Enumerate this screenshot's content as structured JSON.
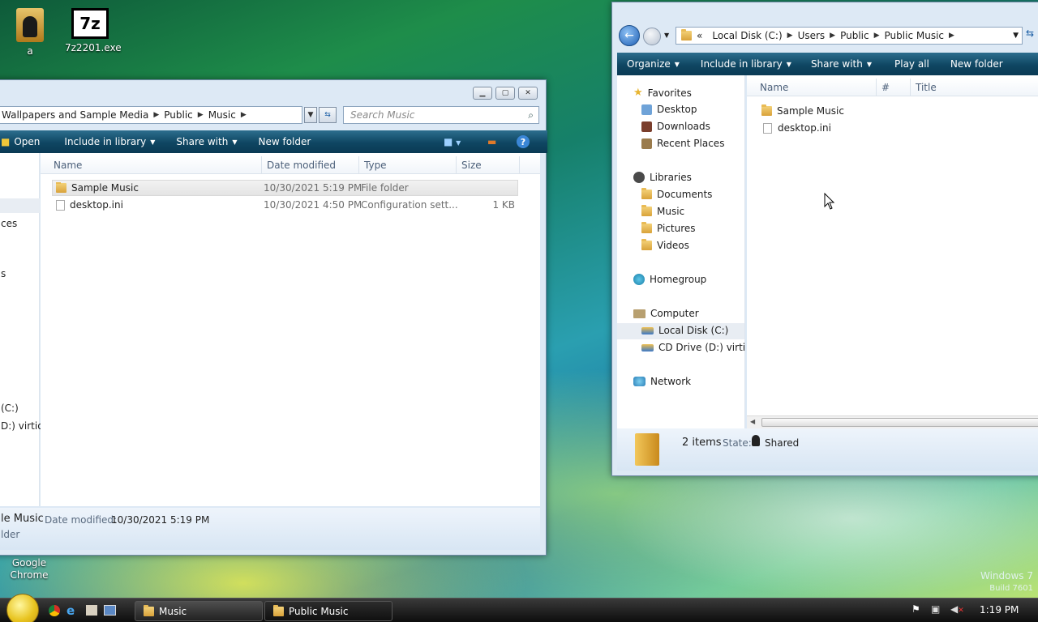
{
  "desktop": {
    "icons": [
      {
        "label": "a",
        "icon": "folder-user-icon"
      },
      {
        "label": "7z2201.exe",
        "icon": "7zip-icon",
        "glyph": "7z"
      },
      {
        "label": "Google Chrome",
        "icon": "chrome-icon"
      }
    ],
    "watermark": {
      "line1": "Windows 7",
      "line2": "Build 7601"
    }
  },
  "left_window": {
    "breadcrumb": [
      "Wallpapers and Sample Media",
      "Public",
      "Music"
    ],
    "search_placeholder": "Search Music",
    "toolbar": {
      "open": "Open",
      "include": "Include in library",
      "share": "Share with",
      "new_folder": "New folder"
    },
    "columns": [
      "Name",
      "Date modified",
      "Type",
      "Size"
    ],
    "rows": [
      {
        "name": "Sample Music",
        "date": "10/30/2021 5:19 PM",
        "type": "File folder",
        "size": ""
      },
      {
        "name": "desktop.ini",
        "date": "10/30/2021 4:50 PM",
        "type": "Configuration sett...",
        "size": "1 KB"
      }
    ],
    "nav_fragments": [
      "ces",
      "s",
      "(C:)",
      "D:) virtio-w"
    ],
    "details": {
      "name": "le Music",
      "date_label": "Date modified:",
      "date_value": "10/30/2021 5:19 PM",
      "type": "lder"
    }
  },
  "right_window": {
    "breadcrumb_prefix": "«",
    "breadcrumb": [
      "Local Disk (C:)",
      "Users",
      "Public",
      "Public Music"
    ],
    "toolbar": {
      "organize": "Organize",
      "include": "Include in library",
      "share": "Share with",
      "play_all": "Play all",
      "new_folder": "New folder"
    },
    "columns": [
      "Name",
      "#",
      "Title"
    ],
    "rows": [
      {
        "name": "Sample Music",
        "kind": "folder"
      },
      {
        "name": "desktop.ini",
        "kind": "file"
      }
    ],
    "nav": {
      "favorites": {
        "label": "Favorites",
        "items": [
          "Desktop",
          "Downloads",
          "Recent Places"
        ]
      },
      "libraries": {
        "label": "Libraries",
        "items": [
          "Documents",
          "Music",
          "Pictures",
          "Videos"
        ]
      },
      "homegroup": "Homegroup",
      "computer": {
        "label": "Computer",
        "items": [
          "Local Disk (C:)",
          "CD Drive (D:) virtio-w"
        ]
      },
      "network": "Network"
    },
    "status": {
      "count": "2 items",
      "state_label": "State:",
      "state_value": "Shared"
    }
  },
  "taskbar": {
    "buttons": [
      {
        "label": "Music"
      },
      {
        "label": "Public Music"
      }
    ],
    "clock": "1:19 PM"
  },
  "colors": {
    "accent": "#0f4662",
    "selection": "#cce8ff"
  }
}
